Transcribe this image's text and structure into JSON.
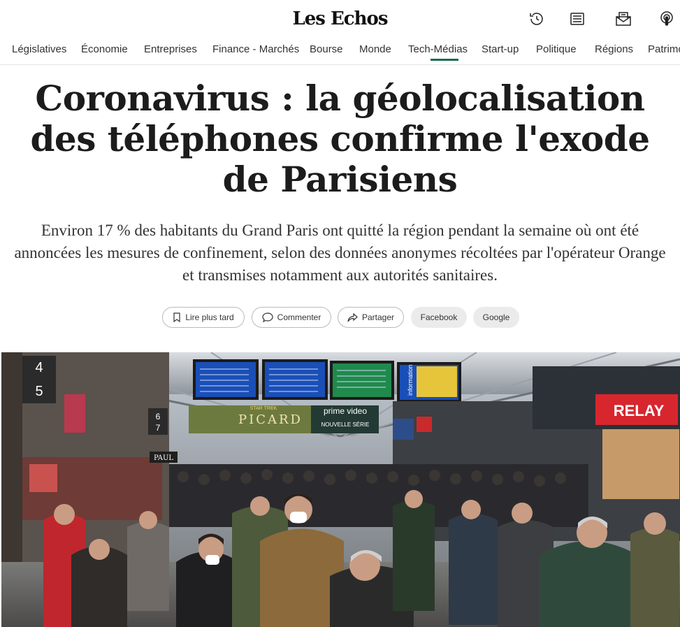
{
  "site": {
    "logo": "Les Echos"
  },
  "header_icons": [
    "history-icon",
    "newspaper-icon",
    "newsletter-icon",
    "podcast-icon"
  ],
  "nav": {
    "items": [
      "Législatives",
      "Économie",
      "Entreprises",
      "Finance - Marchés",
      "Bourse",
      "Monde",
      "Tech-Médias",
      "Start-up",
      "Politique",
      "Régions",
      "Patrimoine"
    ],
    "active": "Tech-Médias"
  },
  "article": {
    "title": "Coronavirus : la géolocalisation des téléphones confirme l'exode de Parisiens",
    "lead": "Environ 17 % des habitants du Grand Paris ont quitté la région pendant la semaine où ont été annoncées les mesures de confinement, selon des données anonymes récoltées par l'opérateur Orange et transmises notamment aux autorités sanitaires."
  },
  "actions": {
    "read_later": "Lire plus tard",
    "comment": "Commenter",
    "share": "Partager",
    "facebook": "Facebook",
    "google": "Google"
  },
  "photo": {
    "platform_numbers": [
      "4",
      "5",
      "6",
      "7"
    ],
    "billboard": "PICARD",
    "billboard_tag": "STAR TREK",
    "prime_video": "prime video",
    "series": "NOUVELLE SÉRIE",
    "relay": "RELAY",
    "paul": "PAUL",
    "information": "information",
    "colors": {
      "accent": "#1a6b4e",
      "relay_red": "#d8262e",
      "board_blue": "#1a4fb8"
    }
  }
}
